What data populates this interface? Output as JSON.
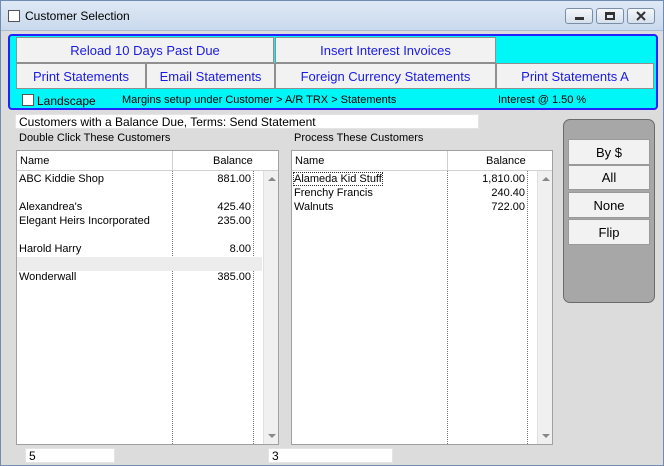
{
  "window": {
    "title": "Customer Selection",
    "controls": [
      "minimize-icon",
      "maximize-icon",
      "close-icon"
    ]
  },
  "toolbar": {
    "reload": "Reload 10 Days Past Due",
    "insert_interest": "Insert Interest Invoices",
    "print_statements": "Print Statements",
    "email_statements": "Email Statements",
    "foreign_currency": "Foreign Currency Statements",
    "print_statements_a": "Print Statements A",
    "landscape": "Landscape",
    "landscape_checked": false,
    "margins_note": "Margins setup under Customer > A/R TRX > Statements",
    "interest": "Interest @ 1.50 %",
    "panel_color": "#00f7f7",
    "border_color": "#2222ff",
    "button_text_color": "#1a1ae6"
  },
  "filter_description": "Customers with a Balance Due, Terms: Send Statement",
  "left_list": {
    "label": "Double Click These Customers",
    "col_name": "Name",
    "col_balance": "Balance",
    "rows": [
      {
        "name": "ABC Kiddie Shop",
        "balance": "881.00"
      },
      {
        "name": "",
        "balance": ""
      },
      {
        "name": "Alexandrea's",
        "balance": "425.40"
      },
      {
        "name": "Elegant Heirs Incorporated",
        "balance": "235.00"
      },
      {
        "name": "",
        "balance": ""
      },
      {
        "name": "Harold Harry",
        "balance": "8.00"
      },
      {
        "name": "",
        "balance": ""
      },
      {
        "name": "Wonderwall",
        "balance": "385.00"
      }
    ],
    "count": "5"
  },
  "right_list": {
    "label": "Process These Customers",
    "col_name": "Name",
    "col_balance": "Balance",
    "rows": [
      {
        "name": "Alameda Kid Stuff",
        "balance": "1,810.00"
      },
      {
        "name": "Frenchy Francis",
        "balance": "240.40"
      },
      {
        "name": "Walnuts",
        "balance": "722.00"
      }
    ],
    "count": "3"
  },
  "side_buttons": {
    "by_dollar": "By $",
    "all": "All",
    "none": "None",
    "flip": "Flip"
  }
}
